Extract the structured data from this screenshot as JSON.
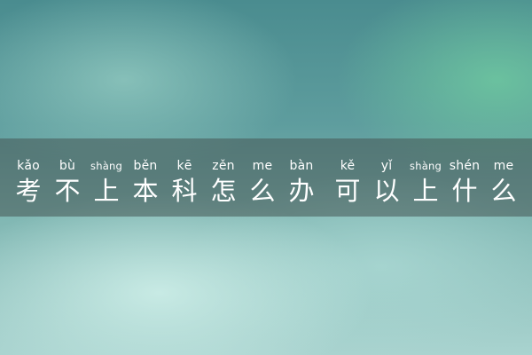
{
  "title": {
    "syllables": [
      {
        "pinyin": "kǎo",
        "hanzi": "考"
      },
      {
        "pinyin": "bù",
        "hanzi": "不"
      },
      {
        "pinyin": "shàng",
        "hanzi": "上"
      },
      {
        "pinyin": "běn",
        "hanzi": "本"
      },
      {
        "pinyin": "kē",
        "hanzi": "科"
      },
      {
        "pinyin": "zěn",
        "hanzi": "怎"
      },
      {
        "pinyin": "me",
        "hanzi": "么"
      },
      {
        "pinyin": "bàn",
        "hanzi": "办"
      },
      {
        "pinyin": "kě",
        "hanzi": "可"
      },
      {
        "pinyin": "yǐ",
        "hanzi": "以"
      },
      {
        "pinyin": "shàng",
        "hanzi": "上"
      },
      {
        "pinyin": "shén",
        "hanzi": "什"
      },
      {
        "pinyin": "me",
        "hanzi": "么"
      }
    ]
  }
}
